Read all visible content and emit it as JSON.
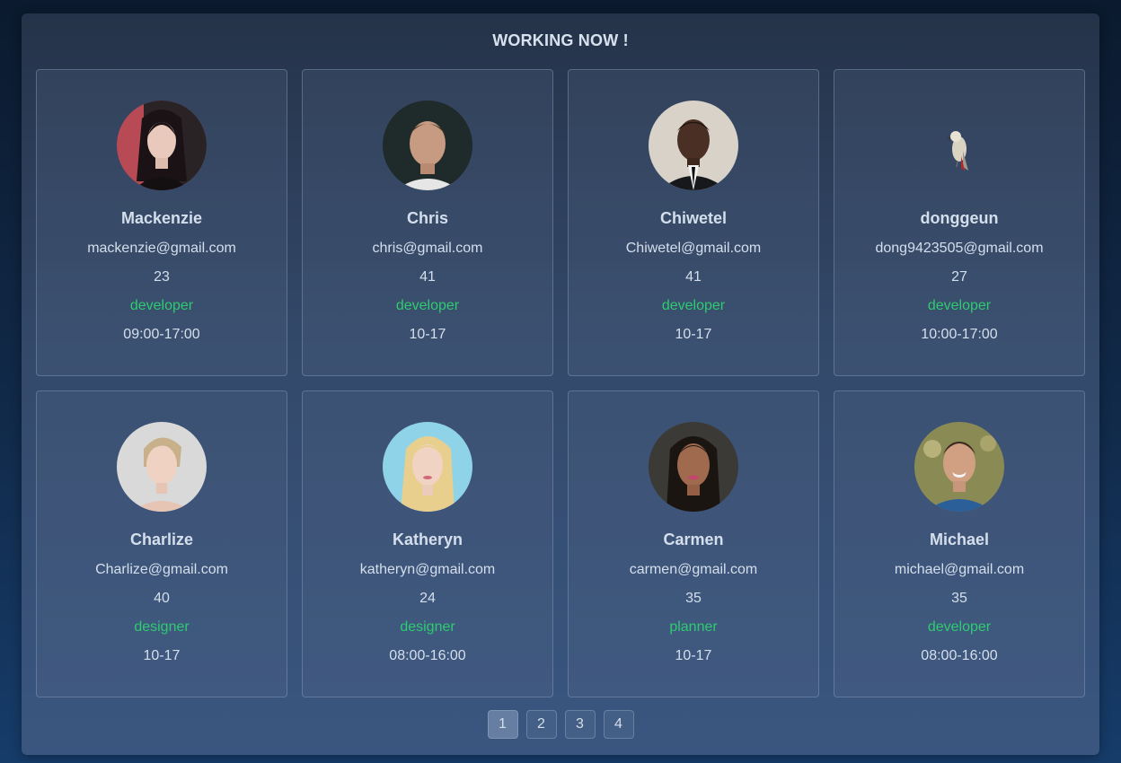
{
  "header": {
    "title": "WORKING NOW !"
  },
  "employees": [
    {
      "name": "Mackenzie",
      "email": "mackenzie@gmail.com",
      "age": "23",
      "role": "developer",
      "hours": "09:00-17:00",
      "avatar": "portrait-woman-dark-hair"
    },
    {
      "name": "Chris",
      "email": "chris@gmail.com",
      "age": "41",
      "role": "developer",
      "hours": "10-17",
      "avatar": "portrait-man-short-hair"
    },
    {
      "name": "Chiwetel",
      "email": "Chiwetel@gmail.com",
      "age": "41",
      "role": "developer",
      "hours": "10-17",
      "avatar": "portrait-man-suit"
    },
    {
      "name": "donggeun",
      "email": "dong9423505@gmail.com",
      "age": "27",
      "role": "developer",
      "hours": "10:00-17:00",
      "avatar": "parrot"
    },
    {
      "name": "Charlize",
      "email": "Charlize@gmail.com",
      "age": "40",
      "role": "designer",
      "hours": "10-17",
      "avatar": "portrait-woman-blonde-short"
    },
    {
      "name": "Katheryn",
      "email": "katheryn@gmail.com",
      "age": "24",
      "role": "designer",
      "hours": "08:00-16:00",
      "avatar": "portrait-woman-blonde-long"
    },
    {
      "name": "Carmen",
      "email": "carmen@gmail.com",
      "age": "35",
      "role": "planner",
      "hours": "10-17",
      "avatar": "portrait-woman-dark-hair"
    },
    {
      "name": "Michael",
      "email": "michael@gmail.com",
      "age": "35",
      "role": "developer",
      "hours": "08:00-16:00",
      "avatar": "portrait-man-smiling"
    }
  ],
  "pagination": {
    "pages": [
      "1",
      "2",
      "3",
      "4"
    ],
    "current": "1"
  },
  "colors": {
    "role": "#2ecc71",
    "text": "#d5dfec"
  }
}
